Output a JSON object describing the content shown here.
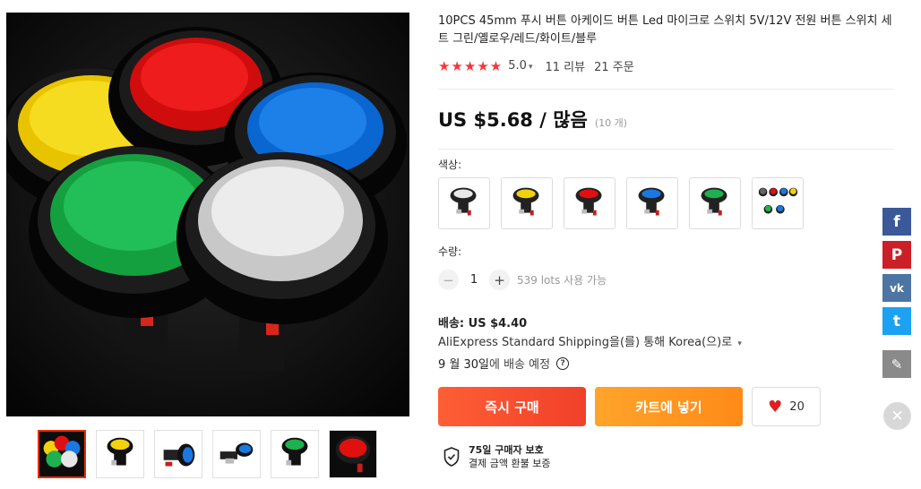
{
  "product": {
    "title": "10PCS 45mm 푸시 버튼 아케이드 버튼 Led 마이크로 스위치 5V/12V 전원 버튼 스위치 세트 그린/옐로우/레드/화이트/블루",
    "stars": "★★★★★",
    "rating": "5.0",
    "reviews": "11 리뷰",
    "orders": "21 주문",
    "price": "US $5.68 / 많음",
    "price_unit": "(10 개)"
  },
  "options": {
    "color_label": "색상:",
    "swatches": [
      "white-button-swatch",
      "yellow-button-swatch",
      "red-button-swatch",
      "blue-button-swatch",
      "green-button-swatch",
      "multi-color-button-swatch"
    ],
    "qty_label": "수량:",
    "qty_minus": "−",
    "qty_value": "1",
    "qty_plus": "+",
    "available": "539 lots 사용 가능"
  },
  "shipping": {
    "title": "배송: US $4.40",
    "method": "AliExpress Standard Shipping을(를) 통해 Korea(으)로",
    "date": "9 월 30일",
    "date_suffix": "에 배송 예정",
    "help": "?"
  },
  "actions": {
    "buy_now": "즉시 구매",
    "add_to_cart": "카트에 넣기",
    "wishlist_count": "20"
  },
  "protection": {
    "line1": "75일 구매자 보호",
    "line2": "결제 금액 환불 보증"
  },
  "social": {
    "facebook": "f",
    "pinterest": "P",
    "vk": "vk",
    "twitter": "t",
    "edit": "✎",
    "close": "✕"
  },
  "colors": {
    "accent": "#f0402a",
    "cart": "#ff8a18",
    "star": "#f2383d"
  }
}
